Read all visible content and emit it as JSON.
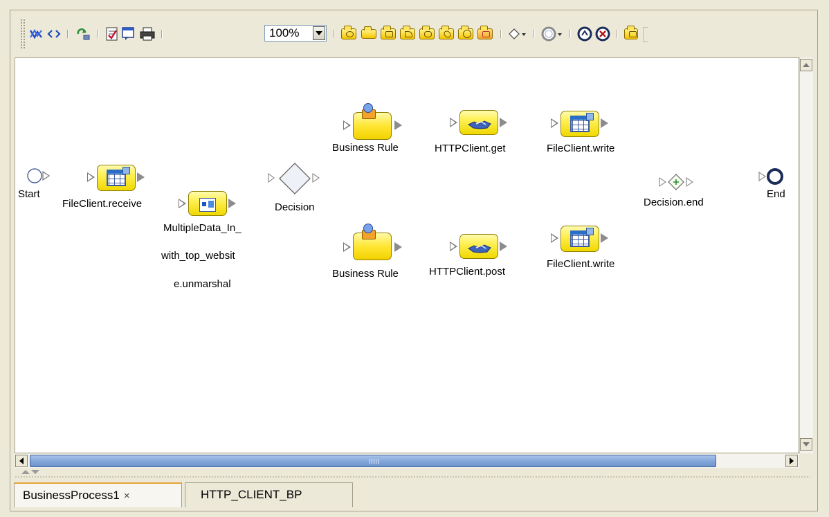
{
  "toolbar": {
    "zoom_value": "100%",
    "icons": [
      "map-icon",
      "code-icon",
      "refresh-icon",
      "validate-icon",
      "note-icon",
      "print-icon",
      "receive-activity-icon",
      "assign-activity-icon",
      "copy-activity-icon",
      "reply-activity-icon",
      "while-activity-icon",
      "empty-activity-icon",
      "timer-activity-icon",
      "throw-activity-icon",
      "decision-dropdown-icon",
      "event-dropdown-icon",
      "compensate-icon",
      "terminate-icon",
      "scope-icon"
    ]
  },
  "diagram": {
    "start": {
      "label": "Start"
    },
    "file_receive": {
      "label": "FileClient.receive"
    },
    "unmarshal": {
      "label_lines": [
        "MultipleData_In_",
        "with_top_websit",
        "e.unmarshal"
      ]
    },
    "decision": {
      "label": "Decision"
    },
    "rule_top": {
      "label": "Business Rule"
    },
    "rule_bottom": {
      "label": "Business Rule"
    },
    "http_get": {
      "label": "HTTPClient.get"
    },
    "http_post": {
      "label": "HTTPClient.post"
    },
    "write_top": {
      "label": "FileClient.write"
    },
    "write_bottom": {
      "label": "FileClient.write"
    },
    "decision_end": {
      "label": "Decision.end"
    },
    "end": {
      "label": "End"
    }
  },
  "tabs": [
    {
      "label": "BusinessProcess1",
      "close": "×",
      "active": true
    },
    {
      "label": "HTTP_CLIENT_BP",
      "active": false
    }
  ],
  "colors": {
    "accent": "#e6a336",
    "activity": "#fff15a",
    "scroll_thumb": "#7fa3d7"
  }
}
